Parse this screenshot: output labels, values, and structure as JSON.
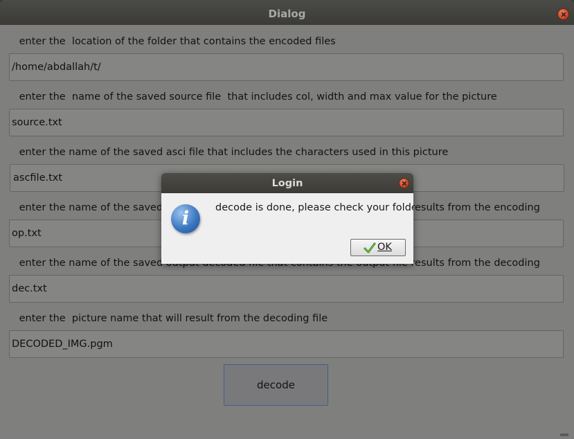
{
  "window": {
    "title": "Dialog"
  },
  "fields": [
    {
      "label": " enter the  location of the folder that contains the encoded files",
      "value": "/home/abdallah/t/"
    },
    {
      "label": " enter the  name of the saved source file  that includes col, width and max value for the picture",
      "value": "source.txt"
    },
    {
      "label": " enter the name of the saved asci file that includes the characters used in this picture",
      "value": "ascfile.txt"
    },
    {
      "label": " enter the name of the saved output encoded file that contains the output file results from the encoding",
      "value": "op.txt"
    },
    {
      "label": " enter the name of the saved output decoded file that contains the output file results from the decoding",
      "value": "dec.txt"
    },
    {
      "label": " enter the  picture name that will result from the decoding file",
      "value": "DECODED_IMG.pgm"
    }
  ],
  "decode_button": {
    "label": "decode"
  },
  "modal": {
    "title": "Login",
    "message": "decode is done, please check your folder",
    "ok_label": "OK",
    "icon": "info-icon"
  },
  "colors": {
    "titlebar": "#3c3b37",
    "close_button": "#d9512c",
    "button_border": "#3e5f90",
    "info_icon": "#3c78c0"
  }
}
